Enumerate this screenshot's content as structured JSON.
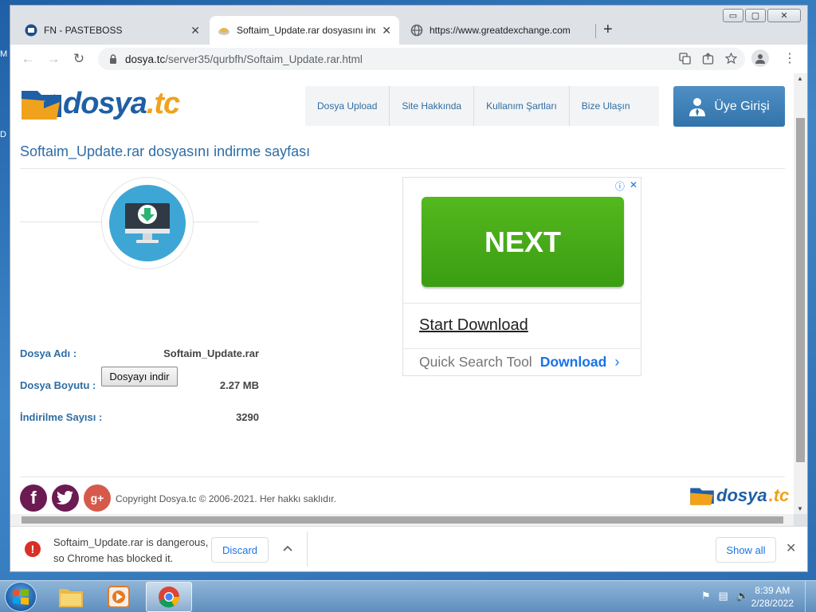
{
  "desktop": {
    "left_letters": [
      "M",
      "D"
    ]
  },
  "window": {
    "minimize": "▭",
    "maximize": "▢",
    "close": "✕"
  },
  "tabs": [
    {
      "title": "FN - PASTEBOSS",
      "icon": "pasteboss-icon"
    },
    {
      "title": "Softaim_Update.rar dosyasını indi",
      "icon": "dosya-favicon"
    },
    {
      "title": "https://www.greatdexchange.com",
      "icon": "globe-icon"
    }
  ],
  "tab_close": "✕",
  "new_tab": "+",
  "toolbar": {
    "back": "←",
    "forward": "→",
    "reload": "↻",
    "url_host": "dosya.tc",
    "url_path": "/server35/qurbfh/Softaim_Update.rar.html"
  },
  "site": {
    "logo_main": "dosya",
    "logo_tc": ".tc",
    "nav": [
      "Dosya Upload",
      "Site Hakkında",
      "Kullanım Şartları",
      "Bize Ulaşın"
    ],
    "login": "Üye Girişi",
    "page_title": "Softaim_Update.rar dosyasını indirme sayfası",
    "file": {
      "name_label": "Dosya Adı :",
      "name_value": "Softaim_Update.rar",
      "size_label": "Dosya Boyutu :",
      "size_value": "2.27 MB",
      "count_label": "İndirilme Sayısı :",
      "count_value": "3290",
      "download_button": "Dosyayı indir"
    },
    "ad": {
      "info": "ⓘ",
      "close": "✕",
      "next": "NEXT",
      "start_download": "Start Download",
      "quick_search": "Quick Search Tool",
      "download": "Download",
      "chevron": "›"
    },
    "social": {
      "facebook": "f",
      "twitter": "t",
      "google_plus": "g+"
    },
    "copyright": "Copyright Dosya.tc © 2006-2021. Her hakkı saklıdır."
  },
  "shelf": {
    "line1": "Softaim_Update.rar is dangerous,",
    "line2": "so Chrome has blocked it.",
    "discard": "Discard",
    "caret": "^",
    "show_all": "Show all",
    "close": "✕"
  },
  "taskbar": {
    "time": "8:39 AM",
    "date": "2/28/2022"
  },
  "colors": {
    "brand_blue": "#2e6da4",
    "brand_orange": "#f0a21c",
    "ad_green": "#3b9d13",
    "danger_red": "#d93025",
    "link_blue": "#1a73e8"
  }
}
